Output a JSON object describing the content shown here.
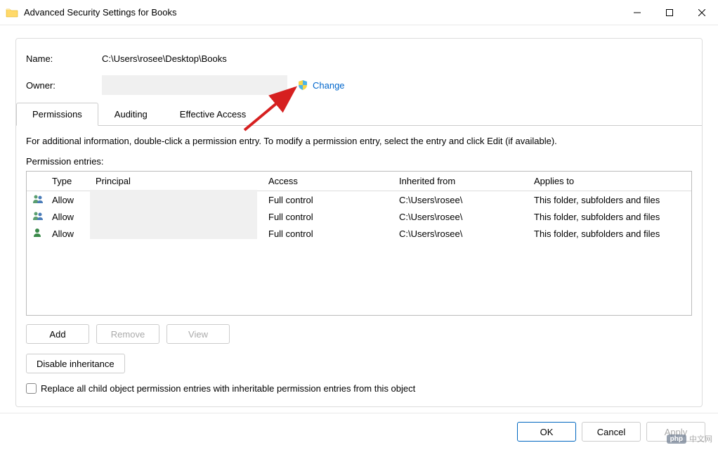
{
  "window": {
    "title": "Advanced Security Settings for Books"
  },
  "fields": {
    "name_label": "Name:",
    "name_value": "C:\\Users\\rosee\\Desktop\\Books",
    "owner_label": "Owner:",
    "change_label": "Change"
  },
  "tabs": {
    "permissions": "Permissions",
    "auditing": "Auditing",
    "effective": "Effective Access"
  },
  "info_text": "For additional information, double-click a permission entry. To modify a permission entry, select the entry and click Edit (if available).",
  "entries_label": "Permission entries:",
  "table": {
    "headers": {
      "type": "Type",
      "principal": "Principal",
      "access": "Access",
      "inherited": "Inherited from",
      "applies": "Applies to"
    },
    "rows": [
      {
        "type": "Allow",
        "access": "Full control",
        "inherited": "C:\\Users\\rosee\\",
        "applies": "This folder, subfolders and files",
        "icon": "users"
      },
      {
        "type": "Allow",
        "access": "Full control",
        "inherited": "C:\\Users\\rosee\\",
        "applies": "This folder, subfolders and files",
        "icon": "users"
      },
      {
        "type": "Allow",
        "access": "Full control",
        "inherited": "C:\\Users\\rosee\\",
        "applies": "This folder, subfolders and files",
        "icon": "user"
      }
    ]
  },
  "buttons": {
    "add": "Add",
    "remove": "Remove",
    "view": "View",
    "disable_inheritance": "Disable inheritance",
    "ok": "OK",
    "cancel": "Cancel",
    "apply": "Apply"
  },
  "checkbox_label": "Replace all child object permission entries with inheritable permission entries from this object",
  "watermark": {
    "badge": "php",
    "text": "中文网"
  }
}
